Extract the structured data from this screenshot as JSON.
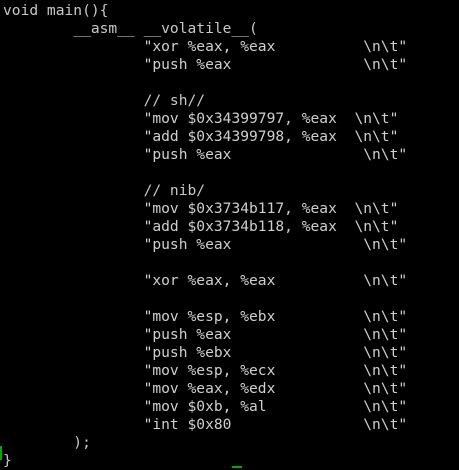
{
  "editor": {
    "lines": [
      "void main(){",
      "        __asm__ __volatile__(",
      "                \"xor %eax, %eax          \\n\\t\"",
      "                \"push %eax               \\n\\t\"",
      "",
      "                // sh//",
      "                \"mov $0x34399797, %eax  \\n\\t\"",
      "                \"add $0x34399798, %eax  \\n\\t\"",
      "                \"push %eax               \\n\\t\"",
      "",
      "                // nib/",
      "                \"mov $0x3734b117, %eax  \\n\\t\"",
      "                \"add $0x3734b118, %eax  \\n\\t\"",
      "                \"push %eax               \\n\\t\"",
      "",
      "                \"xor %eax, %eax          \\n\\t\"",
      "",
      "                \"mov %esp, %ebx          \\n\\t\"",
      "                \"push %eax               \\n\\t\"",
      "                \"push %ebx               \\n\\t\"",
      "                \"mov %esp, %ecx          \\n\\t\"",
      "                \"mov %eax, %edx          \\n\\t\"",
      "                \"mov $0xb, %al           \\n\\t\"",
      "                \"int $0x80               \\n\\t\"",
      "        );",
      "}"
    ]
  },
  "colors": {
    "background": "#000000",
    "text": "#c8c8c8",
    "cursor": "#00a800"
  }
}
